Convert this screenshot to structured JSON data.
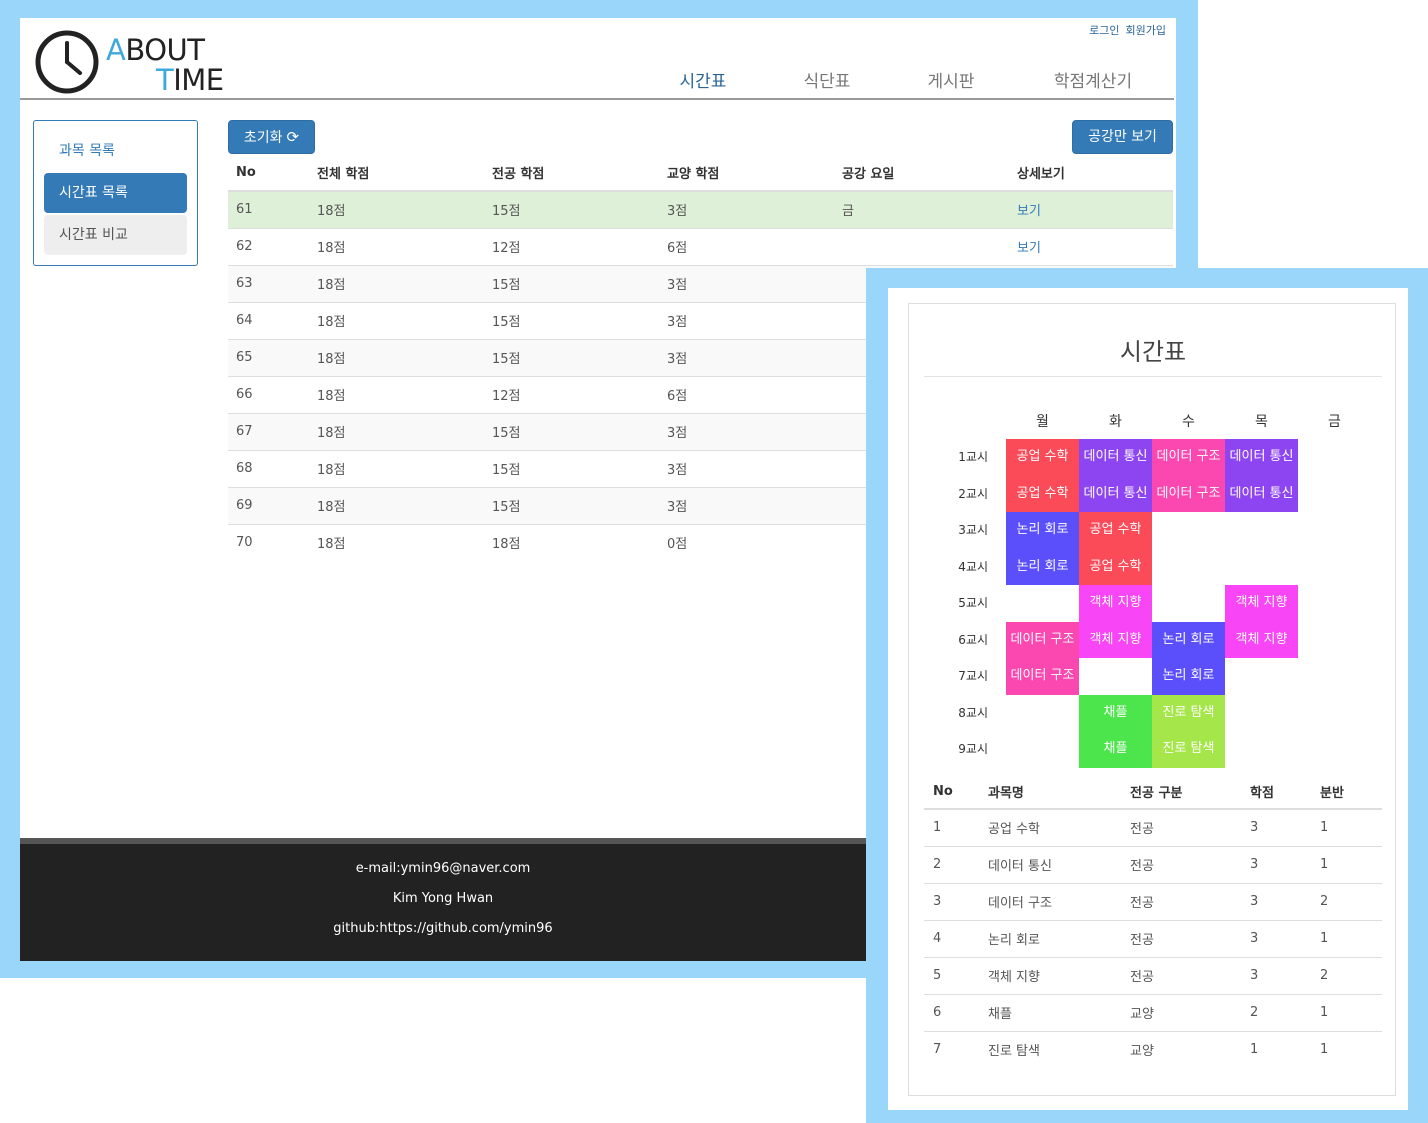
{
  "header": {
    "logo_line1": "ABOUT",
    "logo_line2": "TIME",
    "auth": {
      "login": "로그인",
      "signup": "회원가입"
    },
    "tabs": [
      "시간표",
      "식단표",
      "게시판",
      "학점계산기"
    ]
  },
  "sidebar": {
    "items": [
      "과목 목록",
      "시간표 목록",
      "시간표 비교"
    ]
  },
  "toolbar": {
    "reset_label": "초기화",
    "gong_label": "공강만 보기"
  },
  "list": {
    "columns": [
      "No",
      "전체 학점",
      "전공 학점",
      "교양 학점",
      "공강 요일",
      "상세보기"
    ],
    "rows": [
      [
        "61",
        "18점",
        "15점",
        "3점",
        "금",
        "보기"
      ],
      [
        "62",
        "18점",
        "12점",
        "6점",
        "",
        "보기"
      ],
      [
        "63",
        "18점",
        "15점",
        "3점",
        "",
        ""
      ],
      [
        "64",
        "18점",
        "15점",
        "3점",
        "",
        ""
      ],
      [
        "65",
        "18점",
        "15점",
        "3점",
        "",
        ""
      ],
      [
        "66",
        "18점",
        "12점",
        "6점",
        "",
        ""
      ],
      [
        "67",
        "18점",
        "15점",
        "3점",
        "",
        ""
      ],
      [
        "68",
        "18점",
        "15점",
        "3점",
        "",
        ""
      ],
      [
        "69",
        "18점",
        "15점",
        "3점",
        "",
        ""
      ],
      [
        "70",
        "18점",
        "18점",
        "0점",
        "",
        ""
      ]
    ]
  },
  "footer": {
    "email": "e-mail:ymin96@naver.com",
    "name": "Kim Yong Hwan",
    "github": "github:https://github.com/ymin96"
  },
  "timetable": {
    "title": "시간표",
    "days": [
      "월",
      "화",
      "수",
      "목",
      "금"
    ],
    "periods": [
      "1교시",
      "2교시",
      "3교시",
      "4교시",
      "5교시",
      "6교시",
      "7교시",
      "8교시",
      "9교시"
    ],
    "colors": {
      "공업 수학": "#fb4a58",
      "데이터 통신": "#8d45f2",
      "데이터 구조": "#fb47b0",
      "논리 회로": "#5a4ffb",
      "객체 지향": "#f845f5",
      "채플": "#4ce64c",
      "진로 탐색": "#a5e64a"
    },
    "cells": [
      [
        "공업 수학",
        "데이터 통신",
        "데이터 구조",
        "데이터 통신",
        ""
      ],
      [
        "공업 수학",
        "데이터 통신",
        "데이터 구조",
        "데이터 통신",
        ""
      ],
      [
        "논리 회로",
        "공업 수학",
        "",
        "",
        ""
      ],
      [
        "논리 회로",
        "공업 수학",
        "",
        "",
        ""
      ],
      [
        "",
        "객체 지향",
        "",
        "객체 지향",
        ""
      ],
      [
        "데이터 구조",
        "객체 지향",
        "논리 회로",
        "객체 지향",
        ""
      ],
      [
        "데이터 구조",
        "",
        "논리 회로",
        "",
        ""
      ],
      [
        "",
        "채플",
        "진로 탐색",
        "",
        ""
      ],
      [
        "",
        "채플",
        "진로 탐색",
        "",
        ""
      ]
    ]
  },
  "subjects": {
    "columns": [
      "No",
      "과목명",
      "전공 구분",
      "학점",
      "분반"
    ],
    "rows": [
      [
        "1",
        "공업 수학",
        "전공",
        "3",
        "1"
      ],
      [
        "2",
        "데이터 통신",
        "전공",
        "3",
        "1"
      ],
      [
        "3",
        "데이터 구조",
        "전공",
        "3",
        "2"
      ],
      [
        "4",
        "논리 회로",
        "전공",
        "3",
        "1"
      ],
      [
        "5",
        "객체 지향",
        "전공",
        "3",
        "2"
      ],
      [
        "6",
        "채플",
        "교양",
        "2",
        "1"
      ],
      [
        "7",
        "진로 탐색",
        "교양",
        "1",
        "1"
      ]
    ]
  }
}
